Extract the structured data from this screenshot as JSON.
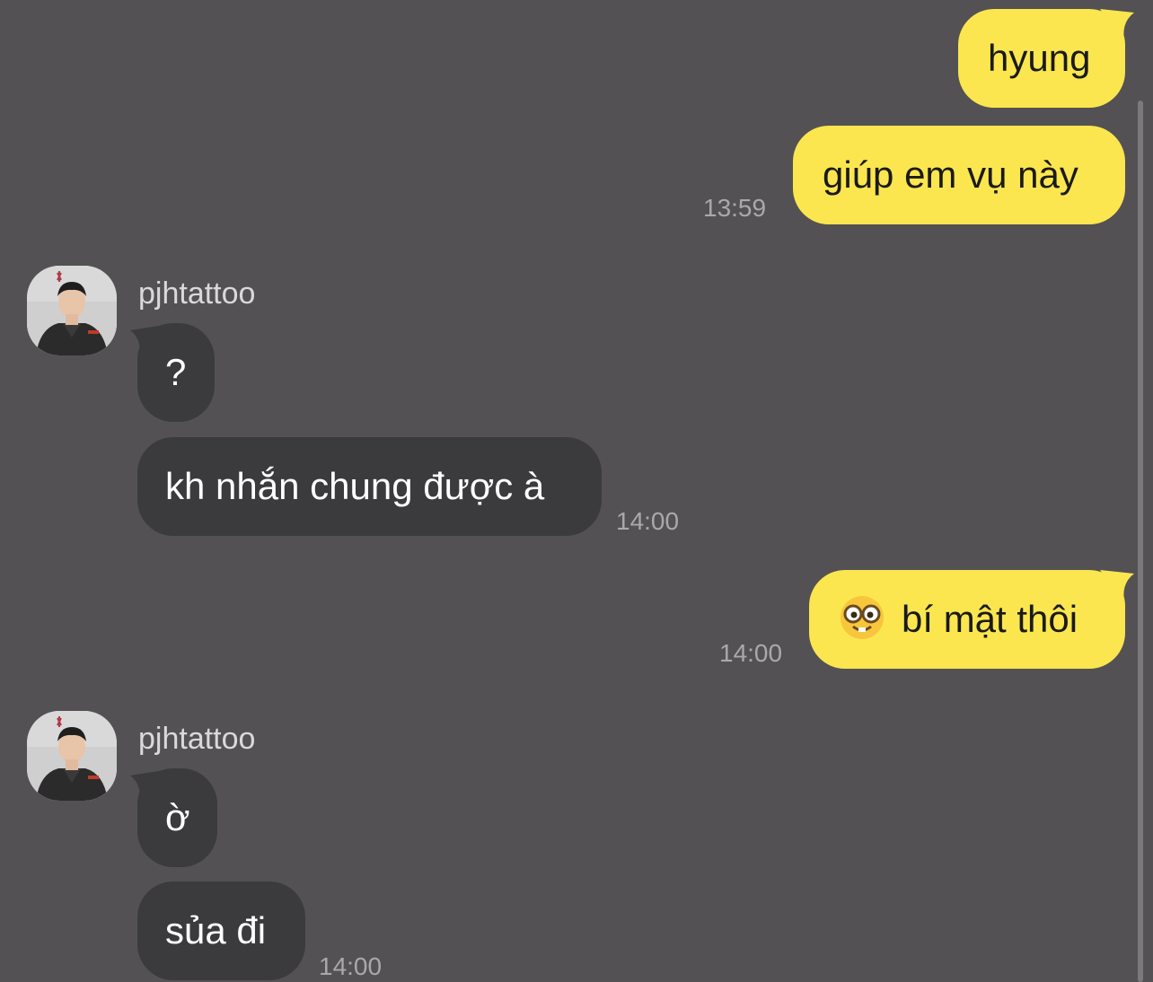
{
  "chat": {
    "messages": [
      {
        "sender": "me",
        "text": "hyung"
      },
      {
        "sender": "me",
        "text": "giúp em vụ này",
        "time": "13:59"
      },
      {
        "sender": "pjhtattoo",
        "text": "?"
      },
      {
        "sender": "pjhtattoo",
        "text": "kh nhắn chung được à",
        "time": "14:00"
      },
      {
        "sender": "me",
        "emoji": "nerd-face",
        "text": "bí mật thôi",
        "time": "14:00"
      },
      {
        "sender": "pjhtattoo",
        "text": "ờ"
      },
      {
        "sender": "pjhtattoo",
        "text": "sủa đi",
        "time": "14:00"
      }
    ],
    "groups": [
      {
        "sender_name": "pjhtattoo"
      },
      {
        "sender_name": "pjhtattoo"
      }
    ]
  },
  "colors": {
    "background": "#535153",
    "my_bubble": "#fbe64f",
    "their_bubble": "#3b3a3c",
    "timestamp": "#a9a8aa"
  },
  "icons": [
    "nerd-face-emoji",
    "avatar-photo"
  ]
}
